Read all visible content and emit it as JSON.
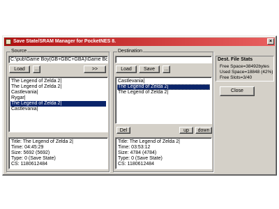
{
  "window": {
    "title": "Save State/SRAM Manager for PocketNES 8.",
    "close_glyph": "×"
  },
  "source": {
    "legend": "Source",
    "path": "C:\\pub\\Game Boy(GB+GBC+GBA)\\Game Boy",
    "load_label": "Load",
    "small_label": "...",
    "transfer_label": ">>",
    "items": [
      "The Legend of Zelda 2|",
      "The Legend of Zelda 2|",
      "Castlevania|",
      "Rygar|",
      "The Legend of Zelda 2|",
      "Castlevania|"
    ],
    "selected_index": 4,
    "info": [
      "Title: The Legend of Zelda 2|",
      "Time: 04:45:29",
      "Size: 5692 (5692)",
      "Type: 0 (Save State)",
      "CS: 1180612484"
    ]
  },
  "destination": {
    "legend": "Destination",
    "path": "",
    "load_label": "Load",
    "save_label": "Save",
    "small_label": "...",
    "items": [
      "Castlevania|",
      "The Legend of Zelda 2|",
      "The Legend of Zelda 2|"
    ],
    "selected_index": 1,
    "del_label": "Del",
    "up_label": "up",
    "down_label": "down",
    "info": [
      "Title: The Legend of Zelda 2|",
      "Time: 03:53:12",
      "Size: 4784 (4784)",
      "Type: 0 (Save State)",
      "CS: 1180612484"
    ]
  },
  "stats": {
    "header": "Dest. File Stats",
    "free_space": "Free Space=38492bytes",
    "used_space": "Used Space=18848 (42%)",
    "free_slots": "Free Slots=3/40"
  },
  "close_label": "Close"
}
